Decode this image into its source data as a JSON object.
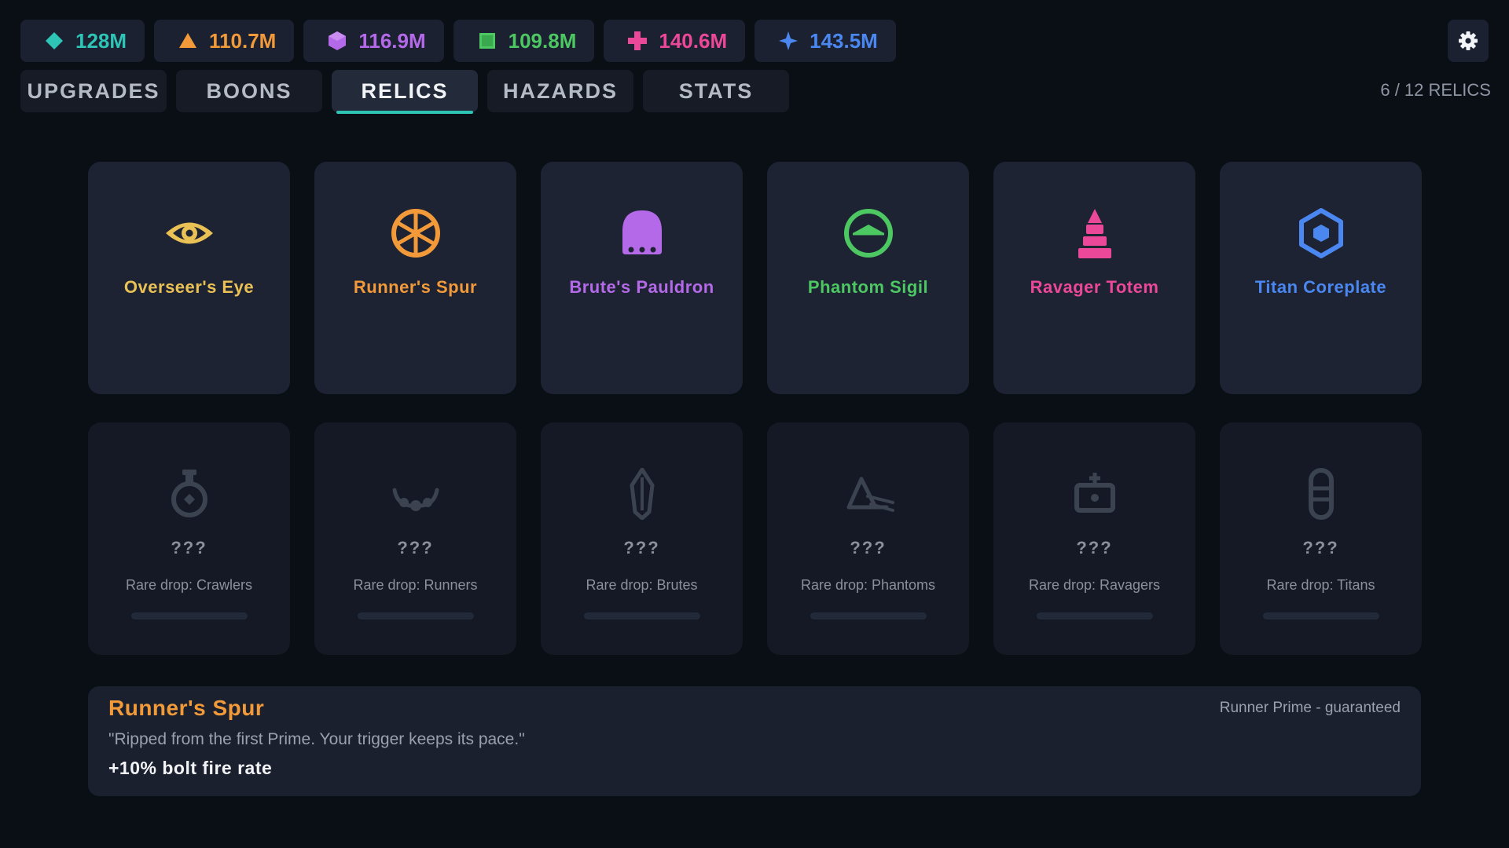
{
  "resources": [
    {
      "value": "128M",
      "icon": "teal-diamond-icon",
      "color": "#2ec4b6"
    },
    {
      "value": "110.7M",
      "icon": "orange-triangle-icon",
      "color": "#f29a3a"
    },
    {
      "value": "116.9M",
      "icon": "purple-hexagon-icon",
      "color": "#b46ae8"
    },
    {
      "value": "109.8M",
      "icon": "green-square-icon",
      "color": "#4cc762"
    },
    {
      "value": "140.6M",
      "icon": "pink-cross-icon",
      "color": "#ec4899"
    },
    {
      "value": "143.5M",
      "icon": "blue-star-icon",
      "color": "#4a87f0"
    }
  ],
  "tabs": [
    {
      "label": "UPGRADES",
      "active": false
    },
    {
      "label": "BOONS",
      "active": false
    },
    {
      "label": "RELICS",
      "active": true
    },
    {
      "label": "HAZARDS",
      "active": false
    },
    {
      "label": "STATS",
      "active": false
    }
  ],
  "relic_count": "6 / 12 RELICS",
  "relics_unlocked": [
    {
      "name": "Overseer's Eye",
      "icon": "eye-icon",
      "color": "#eac155"
    },
    {
      "name": "Runner's Spur",
      "icon": "wheel-icon",
      "color": "#f29a3a"
    },
    {
      "name": "Brute's Pauldron",
      "icon": "pauldron-icon",
      "color": "#b46ae8"
    },
    {
      "name": "Phantom Sigil",
      "icon": "sigil-icon",
      "color": "#4cc762"
    },
    {
      "name": "Ravager Totem",
      "icon": "totem-icon",
      "color": "#ec4899"
    },
    {
      "name": "Titan Coreplate",
      "icon": "hexagon-core-icon",
      "color": "#4a87f0"
    }
  ],
  "relics_locked": [
    {
      "name": "???",
      "hint": "Rare drop: Crawlers",
      "icon": "flask-icon",
      "progress": 0
    },
    {
      "name": "???",
      "hint": "Rare drop: Runners",
      "icon": "necklace-icon",
      "progress": 0
    },
    {
      "name": "???",
      "hint": "Rare drop: Brutes",
      "icon": "crystal-icon",
      "progress": 0
    },
    {
      "name": "???",
      "hint": "Rare drop: Phantoms",
      "icon": "compass-icon",
      "progress": 0
    },
    {
      "name": "???",
      "hint": "Rare drop: Ravagers",
      "icon": "box-icon",
      "progress": 0
    },
    {
      "name": "???",
      "hint": "Rare drop: Titans",
      "icon": "capsule-icon",
      "progress": 0
    }
  ],
  "locked_icon_color": "#3b4250",
  "detail": {
    "title": "Runner's Spur",
    "source": "Runner Prime - guaranteed",
    "quote": "\"Ripped from the first Prime. Your trigger keeps its pace.\"",
    "effect": "+10% bolt fire rate"
  }
}
